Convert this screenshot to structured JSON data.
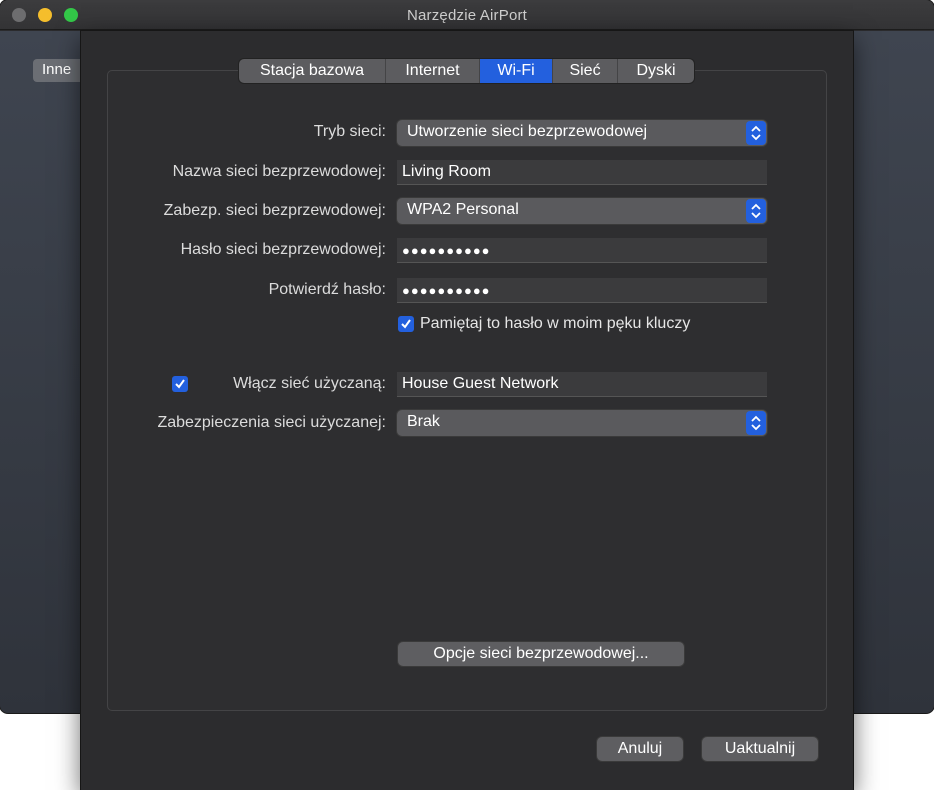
{
  "window": {
    "title": "Narzędzie AirPort"
  },
  "background": {
    "inne_label": "Inne"
  },
  "tabs": [
    {
      "label": "Stacja bazowa",
      "active": false
    },
    {
      "label": "Internet",
      "active": false
    },
    {
      "label": "Wi-Fi",
      "active": true
    },
    {
      "label": "Sieć",
      "active": false
    },
    {
      "label": "Dyski",
      "active": false
    }
  ],
  "form": {
    "network_mode": {
      "label": "Tryb sieci:",
      "value": "Utworzenie sieci bezprzewodowej"
    },
    "network_name": {
      "label": "Nazwa sieci bezprzewodowej:",
      "value": "Living Room"
    },
    "security": {
      "label": "Zabezp. sieci bezprzewodowej:",
      "value": "WPA2 Personal"
    },
    "password": {
      "label": "Hasło sieci bezprzewodowej:",
      "value": "●●●●●●●●●●"
    },
    "confirm_password": {
      "label": "Potwierdź hasło:",
      "value": "●●●●●●●●●●"
    },
    "remember_keychain": {
      "label": "Pamiętaj to hasło w moim pęku kluczy",
      "checked": true
    },
    "guest_network": {
      "label": "Włącz sieć użyczaną:",
      "value": "House Guest Network",
      "checked": true
    },
    "guest_security": {
      "label": "Zabezpieczenia sieci użyczanej:",
      "value": "Brak"
    }
  },
  "buttons": {
    "wireless_options": "Opcje sieci bezprzewodowej...",
    "cancel": "Anuluj",
    "update": "Uaktualnij"
  },
  "colors": {
    "accent": "#2360de",
    "sheet_bg": "#2c2c2e"
  }
}
